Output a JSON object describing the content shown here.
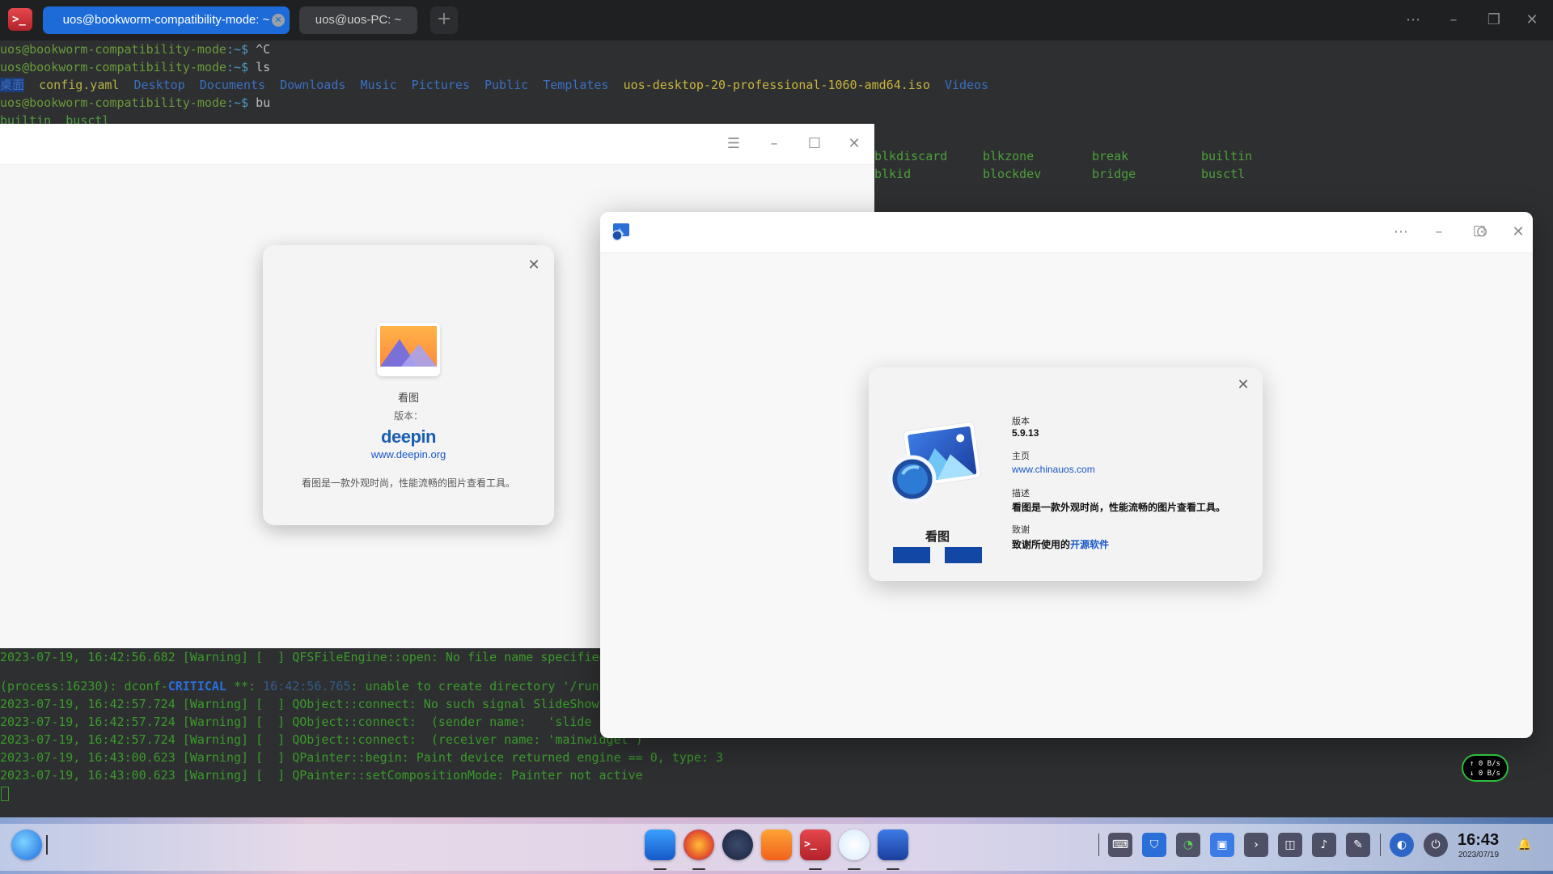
{
  "terminal": {
    "tabs": [
      {
        "label": "uos@bookworm-compatibility-mode: ~",
        "active": true
      },
      {
        "label": "uos@uos-PC: ~",
        "active": false
      }
    ],
    "add_tab": "+",
    "prompt_user": "uos@bookworm-compatibility-mode",
    "prompt_path": ":~$",
    "cmd1": " ^C",
    "cmd2": " ls",
    "ls_items": [
      "桌面",
      "config.yaml",
      "Desktop",
      "Documents",
      "Downloads",
      "Music",
      "Pictures",
      "Public",
      "Templates",
      "uos-desktop-20-professional-1060-amd64.iso",
      "Videos"
    ],
    "cmd3": " bu",
    "completion_partial": "builtin  busctl",
    "completions": [
      [
        "blkdiscard",
        "blkzone",
        "break",
        "builtin"
      ],
      [
        "blkid",
        "blockdev",
        "bridge",
        "busctl"
      ]
    ],
    "log_lines": [
      {
        "ts": "2023-07-19, 16:42:56.682 [Warning] [  ] ",
        "msg": "QFSFileEngine::open: No file name specified"
      },
      {
        "ts": "2023-07-19, 16:42:57.724 [Warning] [  ] ",
        "msg": "QObject::connect: No such signal SlideShowPanel"
      },
      {
        "ts": "2023-07-19, 16:42:57.724 [Warning] [  ] ",
        "msg": "QObject::connect:  (sender name:   'slide"
      },
      {
        "ts": "2023-07-19, 16:42:57.724 [Warning] [  ] ",
        "msg": "QObject::connect:  (receiver name: 'mainwidget')"
      },
      {
        "ts": "2023-07-19, 16:43:00.623 [Warning] [  ] ",
        "msg": "QPainter::begin: Paint device returned engine == 0, type: 3"
      },
      {
        "ts": "2023-07-19, 16:43:00.623 [Warning] [  ] ",
        "msg": "QPainter::setCompositionMode: Painter not active"
      }
    ],
    "critical_prefix": "(process:16230): dconf-",
    "critical_word": "CRITICAL",
    "critical_stars": " **: ",
    "critical_time": "16:42:56.765",
    "critical_msg": ": unable to create directory '/run/"
  },
  "about_small": {
    "app_name": "看图",
    "version_label": "版本：",
    "brand": "deepin",
    "website": "www.deepin.org",
    "description": "看图是一款外观时尚，性能流畅的图片查看工具。"
  },
  "about_big": {
    "app_name": "看图",
    "version_label": "版本",
    "version": "5.9.13",
    "homepage_label": "主页",
    "homepage": "www.chinauos.com",
    "description_label": "描述",
    "description": "看图是一款外观时尚，性能流畅的图片查看工具。",
    "thanks_label": "致谢",
    "thanks_prefix": "致谢所使用的",
    "thanks_link": "开源软件"
  },
  "net_speed": {
    "up": "↑ 0 B/s",
    "down": "↓ 0 B/s"
  },
  "clock": {
    "time": "16:43",
    "date": "2023/07/19"
  },
  "colors": {
    "accent": "#1c6bd8",
    "link": "#1757c8"
  }
}
